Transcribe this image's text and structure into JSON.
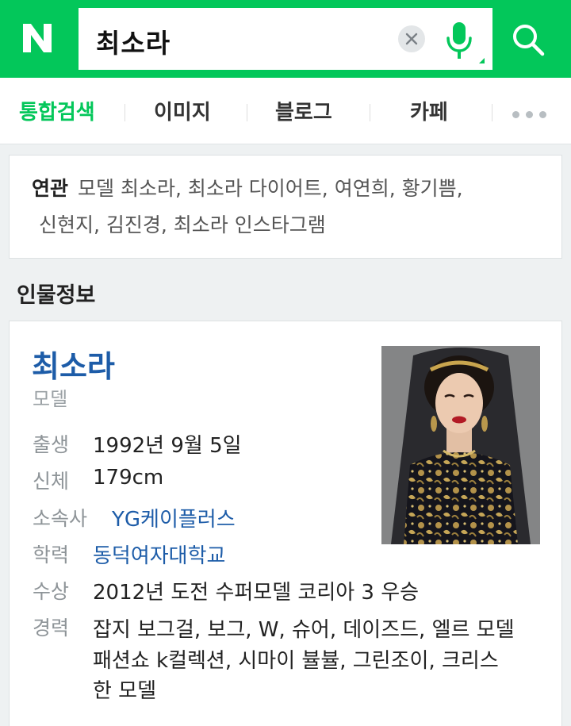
{
  "header": {
    "logo_letter": "N",
    "query": "최소라",
    "brand_color": "#03c75a"
  },
  "tabs": [
    {
      "label": "통합검색",
      "active": true
    },
    {
      "label": "이미지",
      "active": false
    },
    {
      "label": "블로그",
      "active": false
    },
    {
      "label": "카페",
      "active": false
    }
  ],
  "related": {
    "label": "연관",
    "line1": "모델 최소라, 최소라 다이어트, 여연희, 황기쁨,",
    "line2": "신현지, 김진경, 최소라 인스타그램"
  },
  "section_title": "인물정보",
  "person": {
    "name": "최소라",
    "occupation": "모델",
    "info": [
      {
        "label": "출생",
        "value": "1992년 9월 5일",
        "link": false
      },
      {
        "label": "신체",
        "value": "179cm",
        "link": false
      },
      {
        "label": "소속사",
        "value": "YG케이플러스",
        "link": true
      },
      {
        "label": "학력",
        "value": "동덕여자대학교",
        "link": true
      },
      {
        "label": "수상",
        "value": "2012년 도전 수퍼모델 코리아 3 우승",
        "link": false
      }
    ],
    "career_label": "경력",
    "career_lines": [
      "잡지 보그걸, 보그, W, 슈어, 데이즈드, 엘르 모델",
      "패션쇼 k컬렉션, 시마이 뷸뷸, 그린조이, 크리스",
      "한 모델"
    ]
  }
}
